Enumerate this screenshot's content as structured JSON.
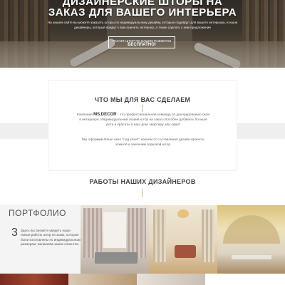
{
  "hero": {
    "title_line1": "ДИЗАЙНЕРСКИЕ ШТОРЫ НА",
    "title_line2": "ЗАКАЗ ДЛЯ ВАШЕГО ИНТЕРЬЕРА",
    "subtitle": "На нашем сайте вы можете заказать шторы по индивидуальному дизайну, которые подойдут для вашего интерьера, и наши дизайнеры, который придут к вам оценить интерьер, а также сделать с ним предложение",
    "button_small": "РАСЧЕТ ШТОР ПО ВАШИМ РАЗМЕРАМ",
    "button_big": "БЕСПЛАТНО!"
  },
  "what": {
    "title": "ЧТО МЫ ДЛЯ ВАС СДЕЛАЕМ",
    "p1_prefix": "Компания",
    "brand": "MS.DECOR",
    "p1_rest": "- это профессиональная команда по декорированию окон в интерьере. Индивидуальный пошив штор на заказ способен добавить больше уюта и красоты в ваш дом, квартиру или офис!",
    "p2": "Мы оформим Ваше окно \"под ключ\": начнем от составления дизайн-проекта, эскизов и закончим отделкой штор."
  },
  "works": {
    "title": "РАБОТЫ НАШИХ ДИЗАЙНЕРОВ"
  },
  "portfolio": {
    "title": "ПОРТФОЛИО",
    "number": "3",
    "text": "Здесь вы сможете увидеть наши новые работы штор на заказ, которые были изготовлены по индивидуальным размерам, желаниям наших клиентов."
  }
}
